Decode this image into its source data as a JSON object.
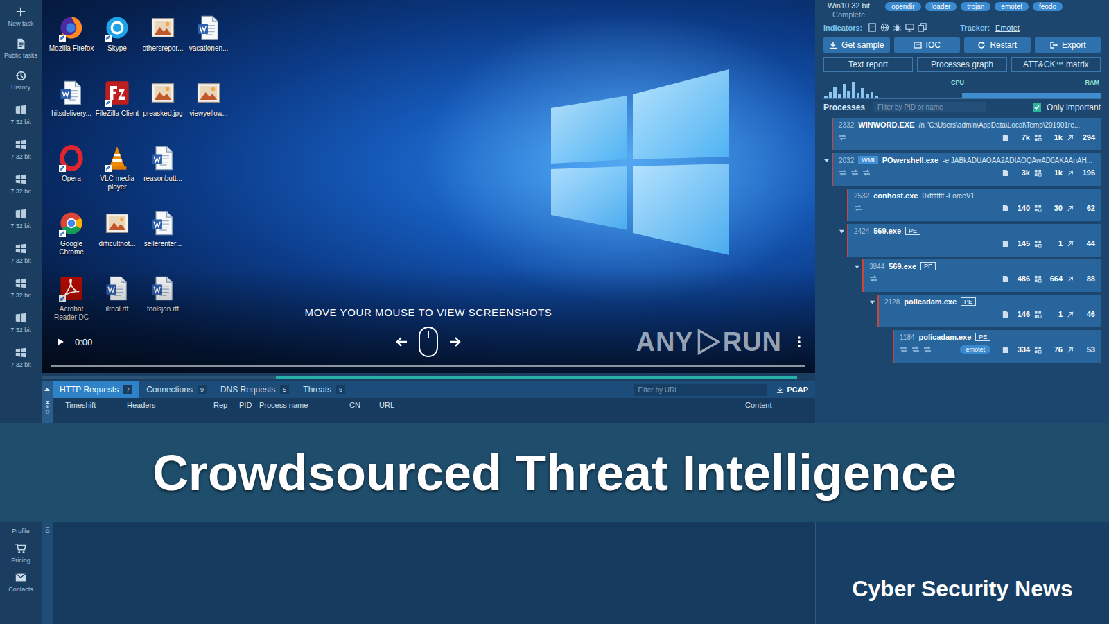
{
  "sidebar": {
    "top": [
      {
        "label": "New task",
        "kind": "plus"
      },
      {
        "label": "Public tasks",
        "kind": "doc"
      },
      {
        "label": "History",
        "kind": "history"
      }
    ],
    "os": [
      {
        "label": "7 32 bit"
      },
      {
        "label": "7 32 bit"
      },
      {
        "label": "7 32 bit"
      },
      {
        "label": "7 32 bit"
      },
      {
        "label": "7 32 bit"
      },
      {
        "label": "7 32 bit"
      },
      {
        "label": "7 32 bit"
      },
      {
        "label": "7 32 bit"
      }
    ],
    "bottom": [
      {
        "label": "Profile",
        "kind": "profile",
        "icon_visible": false
      },
      {
        "label": "Pricing",
        "kind": "cart",
        "icon_visible": true
      },
      {
        "label": "Contacts",
        "kind": "mail",
        "icon_visible": true
      }
    ]
  },
  "desktop": {
    "icons": [
      {
        "label": "Mozilla Firefox",
        "kind": "firefox",
        "shortcut": true
      },
      {
        "label": "hitsdelivery...",
        "kind": "word",
        "shortcut": false
      },
      {
        "label": "Opera",
        "kind": "opera",
        "shortcut": true
      },
      {
        "label": "Google Chrome",
        "kind": "chrome",
        "shortcut": true
      },
      {
        "label": "Acrobat Reader DC",
        "kind": "acrobat",
        "shortcut": true
      },
      {
        "label": "Skype",
        "kind": "skype",
        "shortcut": true
      },
      {
        "label": "FileZilla Client",
        "kind": "filezilla",
        "shortcut": true
      },
      {
        "label": "VLC media player",
        "kind": "vlc",
        "shortcut": true
      },
      {
        "label": "difficultnot...",
        "kind": "image",
        "shortcut": false
      },
      {
        "label": "ilreal.rtf",
        "kind": "word",
        "shortcut": false
      },
      {
        "label": "othersrepor...",
        "kind": "image",
        "shortcut": false
      },
      {
        "label": "preasked.jpg",
        "kind": "image",
        "shortcut": false
      },
      {
        "label": "reasonbutt...",
        "kind": "word",
        "shortcut": false
      },
      {
        "label": "sellerenter...",
        "kind": "word",
        "shortcut": false
      },
      {
        "label": "toolsjan.rtf",
        "kind": "word",
        "shortcut": false
      },
      {
        "label": "vacationen...",
        "kind": "word",
        "shortcut": false
      },
      {
        "label": "viewyellow...",
        "kind": "image",
        "shortcut": false
      }
    ]
  },
  "player": {
    "hint": "MOVE YOUR MOUSE TO VIEW SCREENSHOTS",
    "time": "0:00",
    "watermark": [
      "ANY",
      "RUN"
    ],
    "level": 0
  },
  "network": {
    "side_label": "ORK",
    "tabs": [
      {
        "label": "HTTP Requests",
        "count": "7",
        "selected": true
      },
      {
        "label": "Connections",
        "count": "9",
        "selected": false
      },
      {
        "label": "DNS Requests",
        "count": "5",
        "selected": false
      },
      {
        "label": "Threats",
        "count": "6",
        "selected": false
      }
    ],
    "filter_placeholder": "Filter by URL",
    "pcap": "PCAP",
    "columns": [
      "Timeshift",
      "Headers",
      "Rep",
      "PID",
      "Process name",
      "CN",
      "URL",
      "Content"
    ]
  },
  "task": {
    "os": "Win10 32 bit",
    "status": "Complete",
    "tags": [
      "opendir",
      "loader",
      "trojan",
      "emotet",
      "feodo"
    ],
    "indicators_label": "Indicators:",
    "tracker_label": "Tracker:",
    "tracker_value": "Emotet",
    "actions": [
      {
        "label": "Get sample",
        "kind": "download"
      },
      {
        "label": "IOC",
        "kind": "ioc"
      },
      {
        "label": "Restart",
        "kind": "restart"
      },
      {
        "label": "Export",
        "kind": "export"
      }
    ],
    "reports": [
      "Text report",
      "Processes graph",
      "ATT&CK™ matrix"
    ],
    "chart": {
      "cpu_label": "CPU",
      "ram_label": "RAM",
      "cpu": [
        10,
        35,
        60,
        25,
        75,
        40,
        85,
        30,
        55,
        20,
        35,
        10,
        0,
        0,
        0,
        0,
        0,
        0,
        0,
        0,
        0,
        0,
        0,
        0,
        0,
        0,
        0,
        0,
        0,
        0,
        0,
        0,
        0,
        0,
        0,
        0,
        0,
        0,
        0,
        0,
        0,
        0,
        0,
        0,
        0,
        0,
        0,
        0,
        0,
        0,
        0,
        0,
        0,
        0,
        0,
        0,
        0,
        0,
        0,
        0
      ],
      "ram": [
        0,
        0,
        0,
        0,
        0,
        0,
        0,
        0,
        0,
        0,
        0,
        0,
        0,
        0,
        0,
        0,
        0,
        0,
        0,
        0,
        0,
        0,
        0,
        0,
        0,
        0,
        0,
        0,
        0,
        0,
        30,
        30,
        30,
        30,
        30,
        30,
        30,
        30,
        30,
        30,
        30,
        30,
        30,
        30,
        30,
        30,
        30,
        30,
        30,
        30,
        30,
        30,
        30,
        30,
        30,
        30,
        30,
        30,
        30,
        30
      ]
    },
    "processes": {
      "title": "Processes",
      "filter_placeholder": "Filter by PID or name",
      "only_important": {
        "label": "Only important",
        "checked": true
      },
      "rows": [
        {
          "pid": "2332",
          "prefix_badge": "",
          "name": "WINWORD.EXE",
          "suffix_badge": "",
          "args": "/n \"C:\\Users\\admin\\AppData\\Local\\Temp\\201901re...",
          "depth": 0,
          "expanded": false,
          "marks": 1,
          "tag": "",
          "stats": [
            "7k",
            "1k",
            "294"
          ]
        },
        {
          "pid": "2032",
          "prefix_badge": "WMI",
          "name": "POwershell.exe",
          "suffix_badge": "",
          "args": "-e JABkADUAOAA2ADIAOQAwAD0AKAAnAH...",
          "depth": 0,
          "expanded": true,
          "marks": 3,
          "tag": "",
          "stats": [
            "3k",
            "1k",
            "196"
          ]
        },
        {
          "pid": "2532",
          "prefix_badge": "",
          "name": "conhost.exe",
          "suffix_badge": "",
          "args": "0xffffffff -ForceV1",
          "depth": 1,
          "expanded": false,
          "marks": 1,
          "tag": "",
          "stats": [
            "140",
            "30",
            "62"
          ]
        },
        {
          "pid": "2424",
          "prefix_badge": "",
          "name": "569.exe",
          "suffix_badge": "PE",
          "args": "",
          "depth": 1,
          "expanded": true,
          "marks": 0,
          "tag": "",
          "stats": [
            "145",
            "1",
            "44"
          ]
        },
        {
          "pid": "3844",
          "prefix_badge": "",
          "name": "569.exe",
          "suffix_badge": "PE",
          "args": "",
          "depth": 2,
          "expanded": true,
          "marks": 1,
          "tag": "",
          "stats": [
            "486",
            "664",
            "88"
          ]
        },
        {
          "pid": "2128",
          "prefix_badge": "",
          "name": "policadam.exe",
          "suffix_badge": "PE",
          "args": "",
          "depth": 3,
          "expanded": true,
          "marks": 0,
          "tag": "",
          "stats": [
            "146",
            "1",
            "46"
          ]
        },
        {
          "pid": "1184",
          "prefix_badge": "",
          "name": "policadam.exe",
          "suffix_badge": "PE",
          "args": "",
          "depth": 4,
          "expanded": false,
          "marks": 3,
          "tag": "emotet",
          "stats": [
            "334",
            "76",
            "53"
          ]
        }
      ]
    }
  },
  "banner": {
    "title": "Crowdsourced Threat Intelligence"
  },
  "bottom": {
    "side_label": "DI",
    "brand": "Cyber Security News"
  }
}
